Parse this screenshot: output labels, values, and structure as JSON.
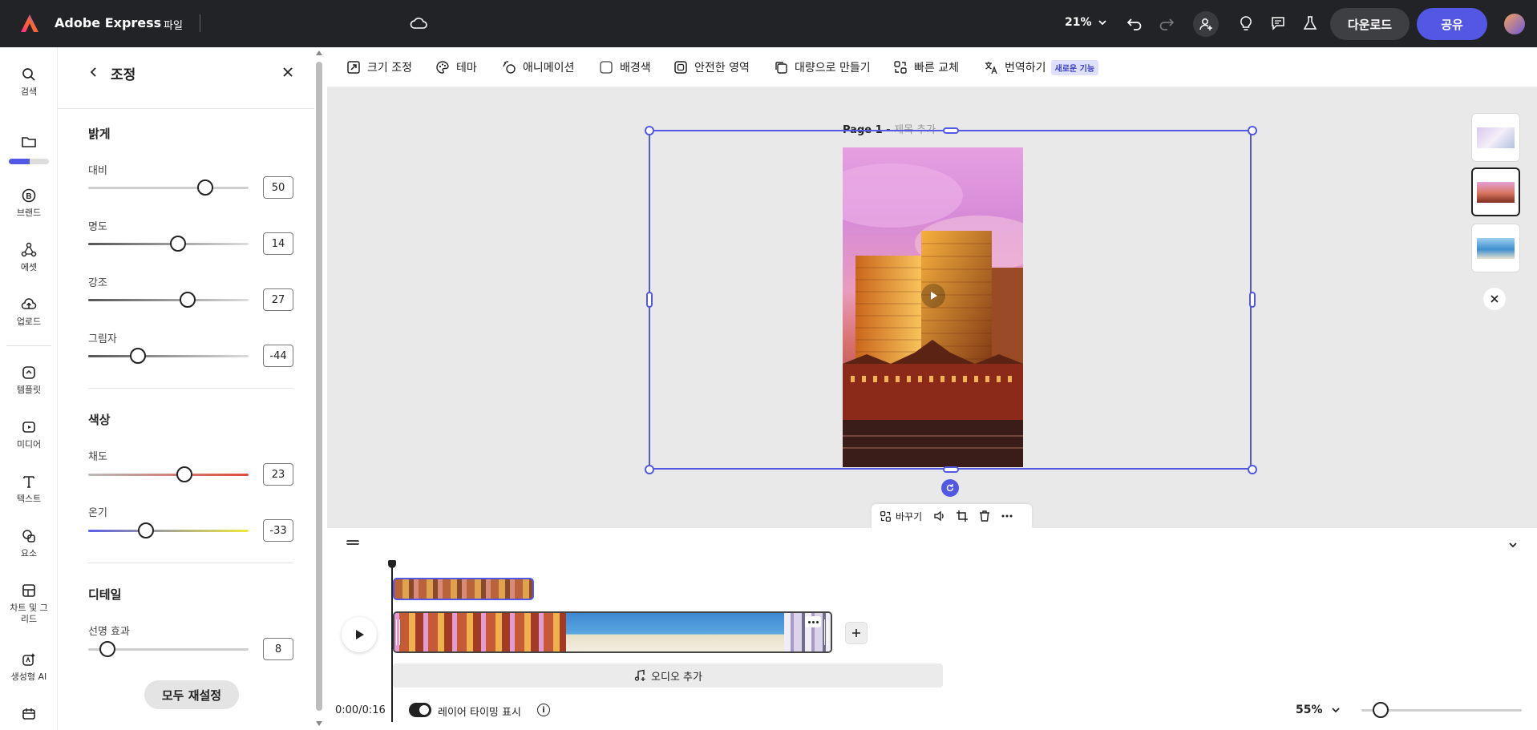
{
  "topbar": {
    "app_name": "Adobe Express",
    "file_menu": "파일",
    "zoom": "21%",
    "download": "다운로드",
    "share": "공유"
  },
  "rail": {
    "items": [
      {
        "label": "검색",
        "icon": "search-icon"
      },
      {
        "label": "",
        "icon": "folder-icon"
      },
      {
        "label": "브랜드",
        "icon": "brand-icon"
      },
      {
        "label": "에셋",
        "icon": "assets-icon"
      },
      {
        "label": "업로드",
        "icon": "upload-icon"
      },
      {
        "label": "템플릿",
        "icon": "template-icon"
      },
      {
        "label": "미디어",
        "icon": "media-icon"
      },
      {
        "label": "텍스트",
        "icon": "text-icon"
      },
      {
        "label": "요소",
        "icon": "elements-icon"
      },
      {
        "label": "차트 및 그리드",
        "icon": "grid-icon"
      },
      {
        "label": "생성형 AI",
        "icon": "ai-icon"
      }
    ]
  },
  "panel": {
    "title": "조정",
    "sections": {
      "light": "밝게",
      "color": "색상",
      "detail": "디테일"
    },
    "sliders": [
      {
        "label": "대비",
        "value": "50",
        "fraction": 0.73
      },
      {
        "label": "명도",
        "value": "14",
        "fraction": 0.56
      },
      {
        "label": "강조",
        "value": "27",
        "fraction": 0.62
      },
      {
        "label": "그림자",
        "value": "-44",
        "fraction": 0.31
      },
      {
        "label": "채도",
        "value": "23",
        "fraction": 0.6
      },
      {
        "label": "온기",
        "value": "-33",
        "fraction": 0.36
      },
      {
        "label": "선명 효과",
        "value": "8",
        "fraction": 0.12
      }
    ],
    "reset": "모두 재설정"
  },
  "toolbar": {
    "resize": "크기 조정",
    "theme": "테마",
    "animation": "애니메이션",
    "background": "배경색",
    "safe_area": "안전한 영역",
    "bulk": "대량으로 만들기",
    "quick_replace": "빠른 교체",
    "translate": "번역하기",
    "new_badge": "새로운 기능"
  },
  "canvas": {
    "page_label": "Page 1 -",
    "page_title_placeholder": "제목 추가",
    "float_replace": "바꾸기"
  },
  "timeline": {
    "add_audio": "오디오 추가",
    "time": "0:00/0:16",
    "layer_timing": "레이어 타이밍 표시",
    "zoom": "55%",
    "zoom_fraction": 0.12
  }
}
